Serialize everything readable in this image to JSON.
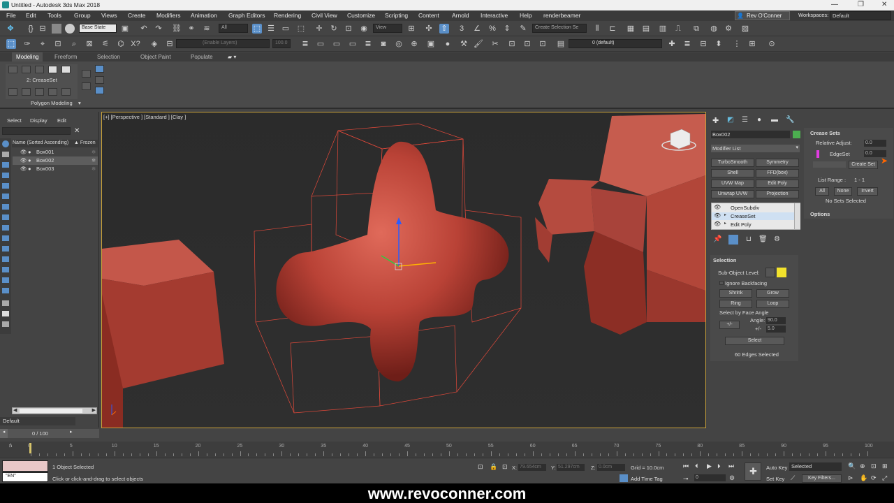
{
  "title": "Untitled - Autodesk 3ds Max 2018",
  "menu": [
    "File",
    "Edit",
    "Tools",
    "Group",
    "Views",
    "Create",
    "Modifiers",
    "Animation",
    "Graph Editors",
    "Rendering",
    "Civil View",
    "Customize",
    "Scripting",
    "Content",
    "Arnold",
    "Interactive",
    "Help",
    "renderbeamer"
  ],
  "user": "Rev O'Conner",
  "workspaces_label": "Workspaces:",
  "workspaces_value": "Default",
  "toolbar": {
    "base_state": "Base State",
    "filter_all": "All",
    "ref_coord": "View",
    "create_selection": "Create Selection Se",
    "enable_layers": "(Enable Layers)",
    "spinner_val": "100.0",
    "layer": "0 (default)"
  },
  "ribbon": {
    "tabs": [
      "Modeling",
      "Freeform",
      "Selection",
      "Object Paint",
      "Populate"
    ],
    "crease_label": "2: CreaseSet",
    "group_label": "Polygon Modeling"
  },
  "explorer": {
    "tabs": [
      "Select",
      "Display",
      "Edit"
    ],
    "col_name": "Name (Sorted Ascending)",
    "col_frozen": "▲ Frozen",
    "objects": [
      "Box001",
      "Box002",
      "Box003"
    ],
    "layer": "Default"
  },
  "viewport": {
    "label": "[+] [Perspective ] [Standard ] [Clay ]"
  },
  "cmd": {
    "object_name": "Box002",
    "modifier_list": "Modifier List",
    "mod_buttons": [
      "TurboSmooth",
      "Symmetry",
      "Shell",
      "FFD(box)",
      "UVW Map",
      "Edit Poly",
      "Unwrap UVW",
      "Projection"
    ],
    "stack": [
      "OpenSubdiv",
      "CreaseSet",
      "Edit Poly"
    ],
    "selection_title": "Selection",
    "subobject_label": "Sub-Object Level:",
    "ignore_backfacing": "Ignore Backfacing",
    "shrink": "Shrink",
    "grow": "Grow",
    "ring": "Ring",
    "loop": "Loop",
    "face_angle": "Select by Face Angle",
    "angle_label": "Angle:",
    "angle_value": "90.0",
    "pm_label": "+/-",
    "pm_value": "5.0",
    "pm_dd": "+/-",
    "select_btn": "Select",
    "edges_selected": "60 Edges Selected"
  },
  "crease": {
    "title": "Crease Sets",
    "relative_label": "Relative Adjust:",
    "relative_value": "0.0",
    "edgeset": "EdgeSet",
    "edgeset_value": "0.0",
    "create_set": "Create Set",
    "list_range_label": "List Range :",
    "list_range_value": "1 - 1",
    "all": "All",
    "none": "None",
    "invert": "Invert",
    "no_sets": "No Sets Selected",
    "options": "Options"
  },
  "timeline": {
    "frame": "0 / 100",
    "ticks": [
      "0",
      "5",
      "10",
      "15",
      "20",
      "25",
      "30",
      "35",
      "40",
      "45",
      "50",
      "55",
      "60",
      "65",
      "70",
      "75",
      "80",
      "85",
      "90",
      "95",
      "100"
    ]
  },
  "status": {
    "selected": "1 Object Selected",
    "hint": "Click or click-and-drag to select objects",
    "x_label": "X:",
    "x_value": "79.654cm",
    "y_label": "Y:",
    "y_value": "51.297cm",
    "z_label": "Z:",
    "z_value": "0.0cm",
    "grid": "Grid = 10.0cm",
    "add_time_tag": "Add Time Tag",
    "auto_key": "Auto Key",
    "set_key": "Set Key",
    "selected_dd": "Selected",
    "key_filters": "Key Filters...",
    "frame_value": "0",
    "lang": "\"EN\""
  },
  "banner": "www.revoconner.com"
}
